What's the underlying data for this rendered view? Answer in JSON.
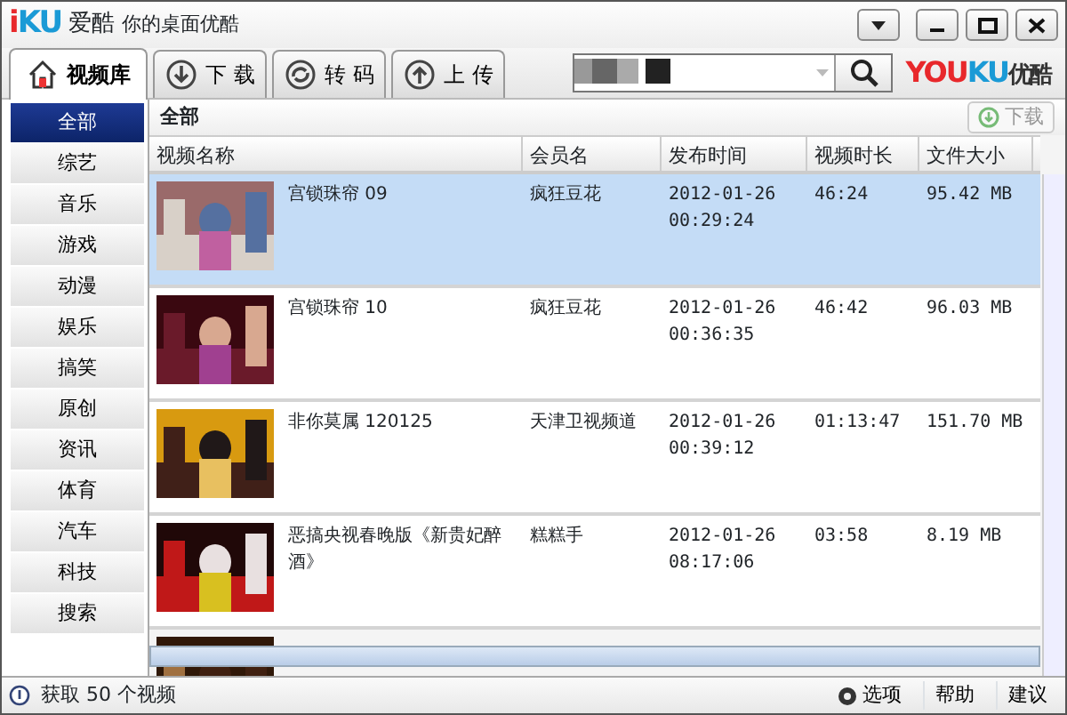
{
  "window": {
    "logo": "iKU",
    "app_name": "爱酷",
    "subtitle": "你的桌面优酷"
  },
  "tabs": [
    {
      "label": "视频库",
      "selected": true
    },
    {
      "label": "下 载",
      "selected": false
    },
    {
      "label": "转 码",
      "selected": false
    },
    {
      "label": "上 传",
      "selected": false
    }
  ],
  "brand": {
    "text": "YOUKU",
    "suffix": "优酷"
  },
  "sidebar": {
    "items": [
      {
        "label": "全部",
        "selected": true
      },
      {
        "label": "综艺",
        "selected": false
      },
      {
        "label": "音乐",
        "selected": false
      },
      {
        "label": "游戏",
        "selected": false
      },
      {
        "label": "动漫",
        "selected": false
      },
      {
        "label": "娱乐",
        "selected": false
      },
      {
        "label": "搞笑",
        "selected": false
      },
      {
        "label": "原创",
        "selected": false
      },
      {
        "label": "资讯",
        "selected": false
      },
      {
        "label": "体育",
        "selected": false
      },
      {
        "label": "汽车",
        "selected": false
      },
      {
        "label": "科技",
        "selected": false
      },
      {
        "label": "搜索",
        "selected": false
      }
    ]
  },
  "content": {
    "heading": "全部",
    "download_button": {
      "label": "下载",
      "disabled": true
    }
  },
  "table": {
    "columns": [
      "视频名称",
      "会员名",
      "发布时间",
      "视频时长",
      "文件大小"
    ],
    "rows": [
      {
        "title": "宫锁珠帘 09",
        "member": "疯狂豆花",
        "date": "2012-01-26",
        "time": "00:29:24",
        "duration": "46:24",
        "size": "95.42 MB",
        "selected": true
      },
      {
        "title": "宫锁珠帘 10",
        "member": "疯狂豆花",
        "date": "2012-01-26",
        "time": "00:36:35",
        "duration": "46:42",
        "size": "96.03 MB",
        "selected": false
      },
      {
        "title": "非你莫属 120125",
        "member": "天津卫视频道",
        "date": "2012-01-26",
        "time": "00:39:12",
        "duration": "01:13:47",
        "size": "151.70 MB",
        "selected": false
      },
      {
        "title": "恶搞央视春晚版《新贵妃醉酒》",
        "member": "糕糕手",
        "date": "2012-01-26",
        "time": "08:17:06",
        "duration": "03:58",
        "size": "8.19 MB",
        "selected": false
      },
      {
        "kind": "picture"
      }
    ]
  },
  "status_bar": {
    "message": "获取 50 个视频",
    "options": "选项",
    "help": "帮助",
    "feedback": "建议"
  }
}
